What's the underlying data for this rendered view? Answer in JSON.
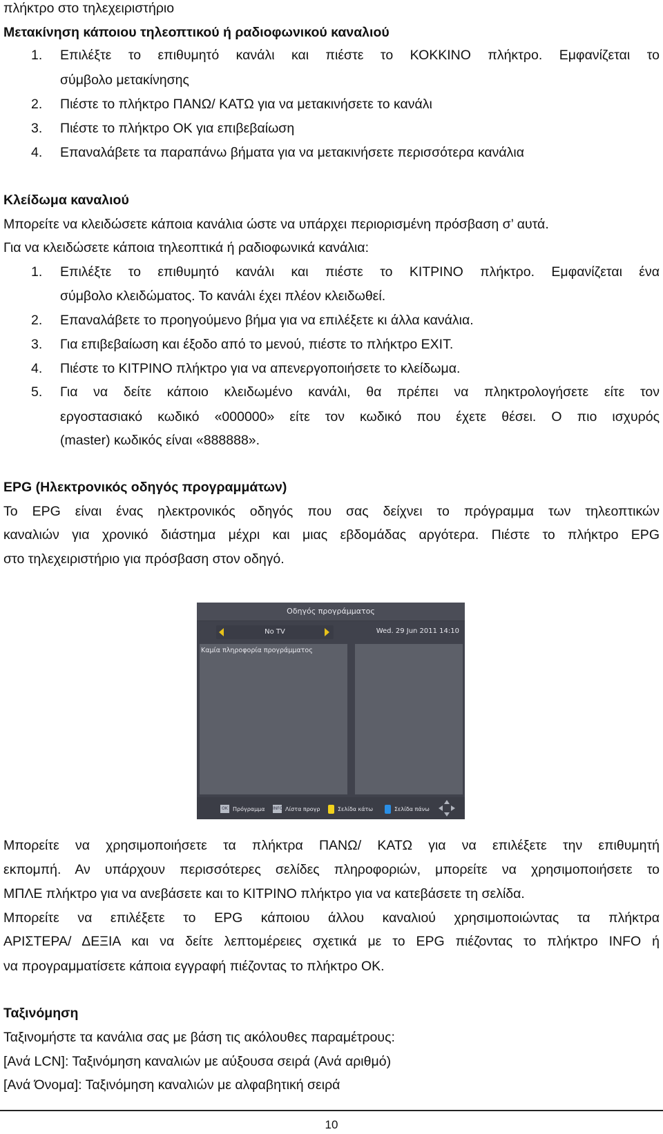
{
  "page": {
    "continuation": "πλήκτρο στο τηλεχειριστήριο",
    "move_section": {
      "heading": "Μετακίνηση κάποιου τηλεοπτικού ή ραδιοφωνικού καναλιού",
      "steps": [
        {
          "num": "1.",
          "lines": [
            "Επιλέξτε το επιθυμητό κανάλι και πιέστε το ΚΟΚΚΙΝΟ πλήκτρο. Εμφανίζεται το",
            "σύμβολο μετακίνησης"
          ]
        },
        {
          "num": "2.",
          "lines": [
            "Πιέστε το πλήκτρο ΠΑΝΩ/ ΚΑΤΩ για να μετακινήσετε το κανάλι"
          ]
        },
        {
          "num": "3.",
          "lines": [
            "Πιέστε το πλήκτρο ΟΚ για επιβεβαίωση"
          ]
        },
        {
          "num": "4.",
          "lines": [
            "Επαναλάβετε τα παραπάνω βήματα για να μετακινήσετε περισσότερα κανάλια"
          ]
        }
      ]
    },
    "lock_section": {
      "heading": "Κλείδωμα καναλιού",
      "intro": [
        "Μπορείτε να κλειδώσετε κάποια κανάλια ώστε να υπάρχει περιορισμένη πρόσβαση σ’ αυτά.",
        "Για να κλειδώσετε κάποια τηλεοπτικά ή ραδιοφωνικά κανάλια:"
      ],
      "steps": [
        {
          "num": "1.",
          "lines": [
            "Επιλέξτε το επιθυμητό κανάλι και πιέστε το ΚΙΤΡΙΝΟ πλήκτρο. Εμφανίζεται ένα",
            "σύμβολο κλειδώματος. Το κανάλι έχει πλέον κλειδωθεί."
          ]
        },
        {
          "num": "2.",
          "lines": [
            "Επαναλάβετε το προηγούμενο βήμα για να επιλέξετε κι άλλα κανάλια."
          ]
        },
        {
          "num": "3.",
          "lines": [
            "Για επιβεβαίωση και έξοδο από το μενού, πιέστε το πλήκτρο EXIT."
          ]
        },
        {
          "num": "4.",
          "lines": [
            "Πιέστε το ΚΙΤΡΙΝΟ πλήκτρο για να απενεργοποιήσετε το κλείδωμα."
          ]
        },
        {
          "num": "5.",
          "lines": [
            "Για να δείτε κάποιο κλειδωμένο κανάλι, θα πρέπει να πληκτρολογήσετε είτε τον",
            "εργοστασιακό κωδικό «000000» είτε τον κωδικό που έχετε θέσει. Ο πιο ισχυρός",
            "(master) κωδικός είναι «888888»."
          ]
        }
      ]
    },
    "epg_section": {
      "heading": "EPG (Ηλεκτρονικός οδηγός προγραμμάτων)",
      "para1": [
        "Το EPG είναι ένας ηλεκτρονικός οδηγός που σας δείχνει το πρόγραμμα των τηλεοπτικών",
        "καναλιών για χρονικό διάστημα μέχρι και μιας εβδομάδας αργότερα. Πιέστε το πλήκτρο EPG",
        "στο τηλεχειριστήριο για πρόσβαση στον οδηγό."
      ],
      "screenshot": {
        "title": "Οδηγός προγράμματος",
        "channel": "No TV",
        "datetime": "Wed.  29 Jun 2011 14:10",
        "no_info": "Καμία πληροφορία προγράμματος",
        "footer_keys": [
          {
            "key": "OK",
            "label": "Πρόγραμμα"
          },
          {
            "key": "INFO",
            "label": "Λίστα προγρ"
          },
          {
            "color": "#f2d21c",
            "label": "Σελίδα κάτω"
          },
          {
            "color": "#2a8fe6",
            "label": "Σελίδα πάνω"
          }
        ]
      },
      "para2": [
        "Μπορείτε να χρησιμοποιήσετε τα πλήκτρα ΠΑΝΩ/ ΚΑΤΩ για να επιλέξετε την επιθυμητή",
        "εκπομπή. Αν υπάρχουν περισσότερες σελίδες πληροφοριών, μπορείτε να χρησιμοποιήσετε το",
        "ΜΠΛΕ πλήκτρο για να ανεβάσετε και το ΚΙΤΡΙΝΟ πλήκτρο για να κατεβάσετε τη σελίδα.",
        "Μπορείτε να επιλέξετε το EPG κάποιου άλλου καναλιού χρησιμοποιώντας τα πλήκτρα",
        "ΑΡΙΣΤΕΡΑ/ ΔΕΞΙΑ και να δείτε λεπτομέρειες σχετικά με το EPG πιέζοντας το πλήκτρο INFO ή",
        "να προγραμματίσετε κάποια εγγραφή πιέζοντας το πλήκτρο OK."
      ]
    },
    "sort_section": {
      "heading": "Ταξινόμηση",
      "lines": [
        "Ταξινομήστε τα κανάλια σας με βάση τις ακόλουθες παραμέτρους:",
        "[Ανά LCN]: Ταξινόμηση καναλιών με αύξουσα σειρά (Ανά αριθμό)",
        "[Ανά Όνομα]: Ταξινόμηση καναλιών με αλφαβητική σειρά"
      ]
    },
    "page_number": "10"
  }
}
